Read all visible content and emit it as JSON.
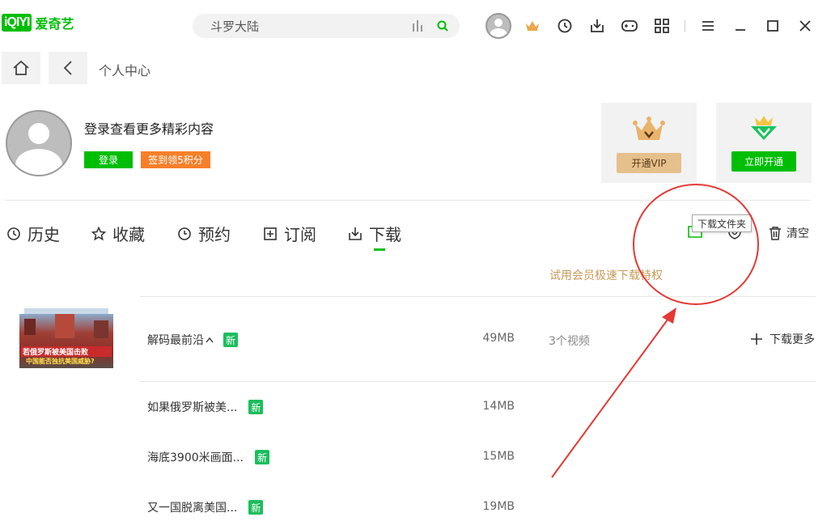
{
  "app": {
    "logo_box": "iQIYI",
    "logo_text": "爱奇艺"
  },
  "search": {
    "value": "斗罗大陆"
  },
  "nav": {
    "breadcrumb": "个人中心"
  },
  "profile": {
    "hint": "登录查看更多精彩内容",
    "login_label": "登录",
    "sign_label": "签到领5积分"
  },
  "cards": [
    {
      "label": "开通VIP"
    },
    {
      "label": "立即开通"
    }
  ],
  "tabs": [
    {
      "label": "历史"
    },
    {
      "label": "收藏"
    },
    {
      "label": "预约"
    },
    {
      "label": "订阅"
    },
    {
      "label": "下载"
    }
  ],
  "actions": {
    "tooltip": "下载文件夹",
    "clear_label": "清空"
  },
  "promo": {
    "trial": "试用会员极速下载特权"
  },
  "downloads": {
    "group": {
      "title": "解码最前沿",
      "badge": "新",
      "size": "49MB",
      "count": "3个视频",
      "more_label": "下载更多",
      "thumb_caption_1": "若俄罗斯被美国击败",
      "thumb_caption_2": "中国能否独抗美国威胁?"
    },
    "items": [
      {
        "title": "如果俄罗斯被美...",
        "badge": "新",
        "size": "14MB"
      },
      {
        "title": "海底3900米画面...",
        "badge": "新",
        "size": "15MB"
      },
      {
        "title": "又一国脱离美国...",
        "badge": "新",
        "size": "19MB"
      }
    ]
  },
  "colors": {
    "brand": "#00be06",
    "annotation": "#e53935",
    "orange": "#f77f2a",
    "gold": "#c89b5a"
  }
}
